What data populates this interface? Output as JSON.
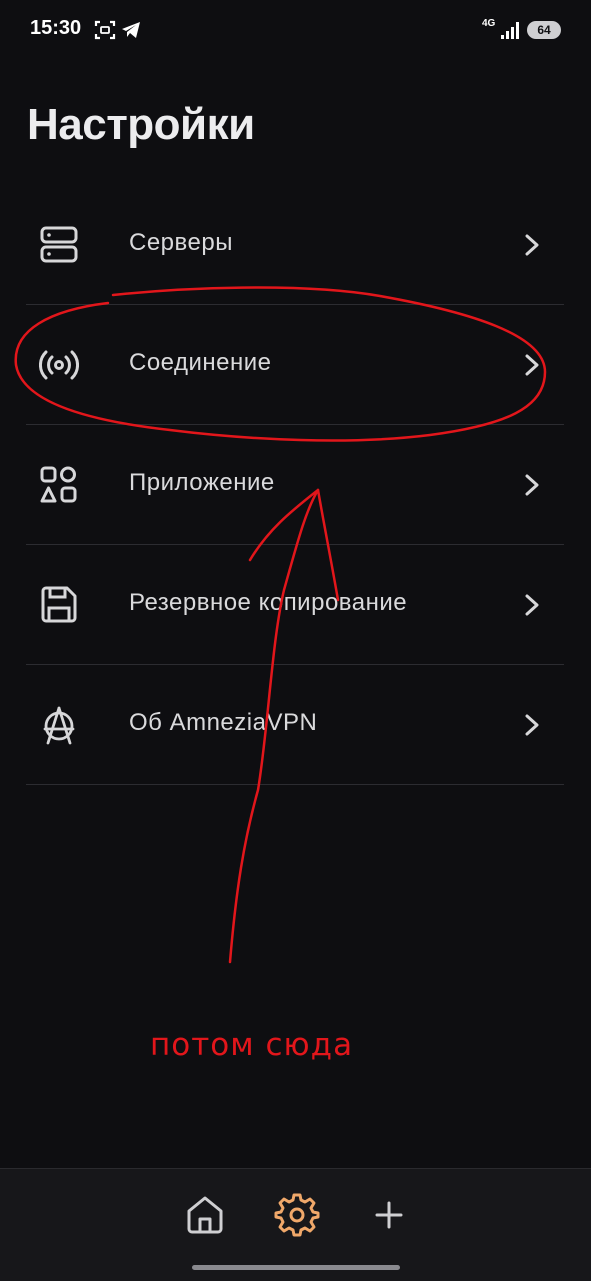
{
  "status_bar": {
    "time": "15:30",
    "network": "4G",
    "battery": "64",
    "icons": [
      "screenshot-icon",
      "telegram-icon",
      "signal-icon"
    ]
  },
  "page": {
    "title": "Настройки"
  },
  "settings": {
    "items": [
      {
        "label": "Серверы",
        "icon": "servers-icon"
      },
      {
        "label": "Соединение",
        "icon": "connection-icon"
      },
      {
        "label": "Приложение",
        "icon": "application-icon"
      },
      {
        "label": "Резервное копирование",
        "icon": "backup-icon"
      },
      {
        "label": "Об AmneziaVPN",
        "icon": "amnezia-logo-icon"
      }
    ]
  },
  "annotation": {
    "text": "потом сюда",
    "color": "#e2161b"
  },
  "bottom_nav": {
    "items": [
      {
        "name": "home",
        "icon": "home-icon",
        "active": false
      },
      {
        "name": "settings",
        "icon": "gear-icon",
        "active": true
      },
      {
        "name": "add",
        "icon": "plus-icon",
        "active": false
      }
    ],
    "active_color": "#f0a86a",
    "inactive_color": "#cfcfd2"
  },
  "colors": {
    "background": "#0e0e11",
    "text": "#dadadc",
    "divider": "#2c2c31"
  }
}
